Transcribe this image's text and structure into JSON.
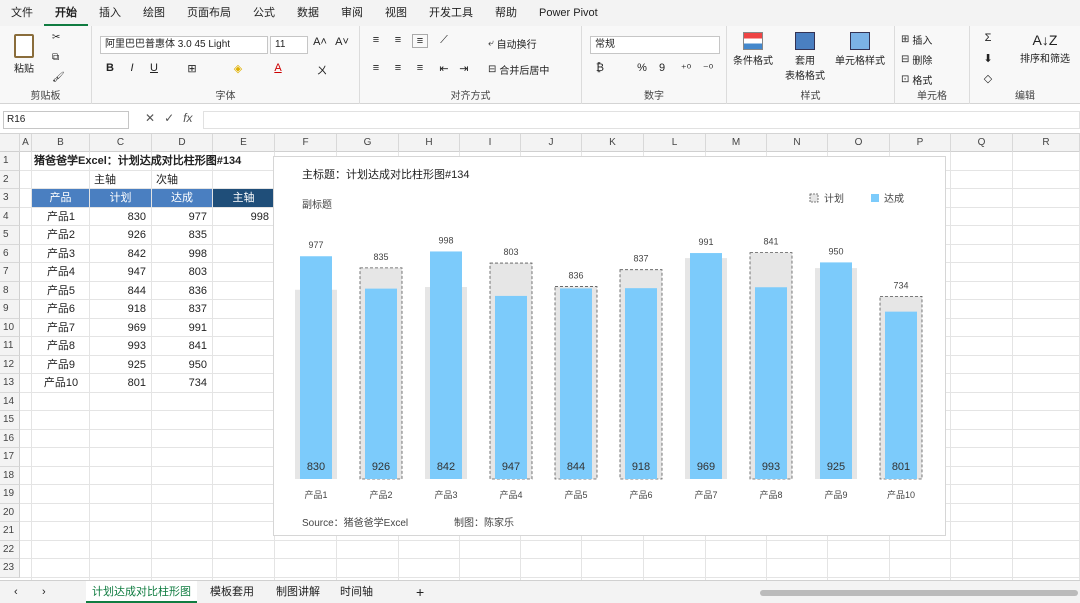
{
  "menu": [
    "文件",
    "开始",
    "插入",
    "绘图",
    "页面布局",
    "公式",
    "数据",
    "审阅",
    "视图",
    "开发工具",
    "帮助",
    "Power Pivot"
  ],
  "menu_active": "开始",
  "ribbon": {
    "clipboard": {
      "paste": "粘贴",
      "label": "剪贴板"
    },
    "font": {
      "name": "阿里巴巴普惠体 3.0 45 Light",
      "size": "11",
      "label": "字体"
    },
    "alignment": {
      "wrap": "自动换行",
      "merge": "合并后居中",
      "label": "对齐方式"
    },
    "number": {
      "format": "常规",
      "label": "数字"
    },
    "styles": {
      "conditional": "条件格式",
      "table": "套用\n表格格式",
      "cell": "单元格样式",
      "label": "样式"
    },
    "cells": {
      "insert": "插入",
      "delete": "删除",
      "format": "格式",
      "label": "单元格"
    },
    "editing": {
      "sort": "排序和筛选",
      "label": "编辑"
    }
  },
  "namebox": "R16",
  "columns": [
    "A",
    "B",
    "C",
    "D",
    "E",
    "F",
    "G",
    "H",
    "I",
    "J",
    "K",
    "L",
    "M",
    "N",
    "O",
    "P",
    "Q",
    "R"
  ],
  "rows": [
    "1",
    "2",
    "3",
    "4",
    "5",
    "6",
    "7",
    "8",
    "9",
    "10",
    "11",
    "12",
    "13",
    "14",
    "15",
    "16",
    "17",
    "18",
    "19",
    "20",
    "21",
    "22",
    "23"
  ],
  "sheet": {
    "title": "猪爸爸学Excel：计划达成对比柱形图#134",
    "axis_row": {
      "primary": "主轴",
      "secondary": "次轴"
    },
    "headers": [
      "产品",
      "计划",
      "达成",
      "主轴"
    ],
    "e4": "998",
    "table": [
      [
        "产品1",
        "830",
        "977"
      ],
      [
        "产品2",
        "926",
        "835"
      ],
      [
        "产品3",
        "842",
        "998"
      ],
      [
        "产品4",
        "947",
        "803"
      ],
      [
        "产品5",
        "844",
        "836"
      ],
      [
        "产品6",
        "918",
        "837"
      ],
      [
        "产品7",
        "969",
        "991"
      ],
      [
        "产品8",
        "993",
        "841"
      ],
      [
        "产品9",
        "925",
        "950"
      ],
      [
        "产品10",
        "801",
        "734"
      ]
    ]
  },
  "chart_data": {
    "type": "bar",
    "title": "主标题：计划达成对比柱形图#134",
    "subtitle": "副标题",
    "categories": [
      "产品1",
      "产品2",
      "产品3",
      "产品4",
      "产品5",
      "产品6",
      "产品7",
      "产品8",
      "产品9",
      "产品10"
    ],
    "series": [
      {
        "name": "计划",
        "values": [
          830,
          926,
          842,
          947,
          844,
          918,
          969,
          993,
          925,
          801
        ]
      },
      {
        "name": "达成",
        "values": [
          977,
          835,
          998,
          803,
          836,
          837,
          991,
          841,
          950,
          734
        ]
      }
    ],
    "ylim": [
      0,
      1000
    ],
    "legend_position": "top-right",
    "source": "Source：猪爸爸学Excel",
    "author": "制图：陈家乐",
    "colors": {
      "plan": "#e6e6e6",
      "actual": "#7ccbfb",
      "plan_border": "#555555"
    }
  },
  "tabs": [
    "计划达成对比柱形图",
    "模板套用",
    "制图讲解",
    "时间轴"
  ],
  "tabs_active": "计划达成对比柱形图"
}
